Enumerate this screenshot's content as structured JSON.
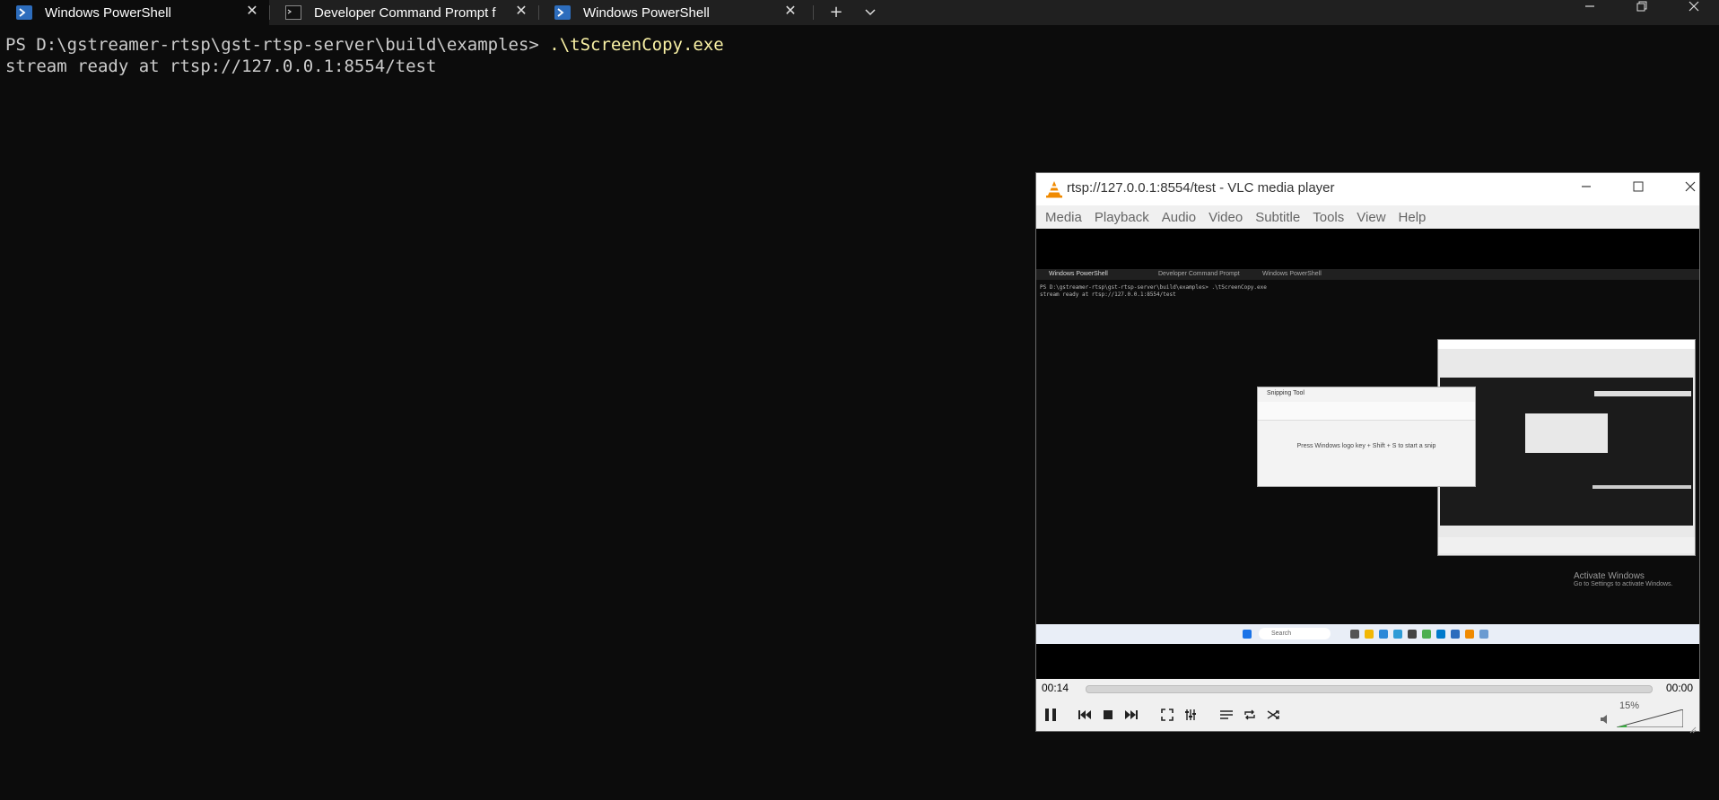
{
  "terminal": {
    "tabs": [
      {
        "label": "Windows PowerShell",
        "active": true,
        "icon": "powershell-icon"
      },
      {
        "label": "Developer Command Prompt f",
        "active": false,
        "icon": "cmd-icon"
      },
      {
        "label": "Windows PowerShell",
        "active": false,
        "icon": "powershell-icon"
      }
    ],
    "new_tab": "+",
    "dropdown": "⌄",
    "prompt": "PS D:\\gstreamer-rtsp\\gst-rtsp-server\\build\\examples> ",
    "command": ".\\tScreenCopy.exe",
    "output": "stream ready at rtsp://127.0.0.1:8554/test",
    "colors": {
      "background": "#0c0c0c",
      "tabbar": "#202020",
      "command": "#f9f1a5"
    }
  },
  "vlc": {
    "title": "rtsp://127.0.0.1:8554/test - VLC media player",
    "menu": [
      "Media",
      "Playback",
      "Audio",
      "Video",
      "Subtitle",
      "Tools",
      "View",
      "Help"
    ],
    "elapsed": "00:14",
    "total": "00:00",
    "volume": "15%",
    "volume_level": 0.15,
    "capture": {
      "tab1": "Windows PowerShell",
      "tab2": "Developer Command Prompt",
      "tab3": "Windows PowerShell",
      "term_line1": "PS D:\\gstreamer-rtsp\\gst-rtsp-server\\build\\examples> .\\tScreenCopy.exe",
      "term_line2": "stream ready at rtsp://127.0.0.1:8554/test",
      "snip_title": "Snipping Tool",
      "snip_text": "Press Windows logo key + Shift + S to start a snip",
      "activate_title": "Activate Windows",
      "activate_sub": "Go to Settings to activate Windows.",
      "taskbar_search": "Search"
    }
  }
}
